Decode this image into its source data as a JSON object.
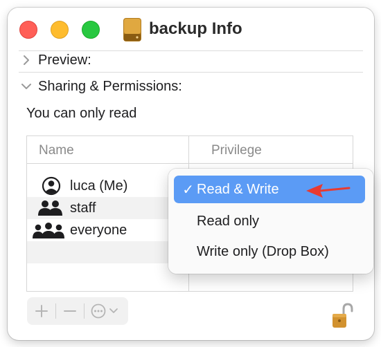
{
  "window": {
    "title": "backup Info",
    "colors": {
      "close": "#ff5f57",
      "minimize": "#febc2e",
      "maximize": "#28c840"
    }
  },
  "sections": {
    "preview_label": "Preview:",
    "sharing_label": "Sharing & Permissions:",
    "sharing_note": "You can only read"
  },
  "permissions_table": {
    "columns": [
      "Name",
      "Privilege"
    ],
    "rows": [
      {
        "name": "luca (Me)",
        "icon": "person-icon"
      },
      {
        "name": "staff",
        "icon": "group-icon"
      },
      {
        "name": "everyone",
        "icon": "everyone-icon"
      }
    ]
  },
  "toolbar": {
    "add_icon": "plus-icon",
    "remove_icon": "minus-icon",
    "action_icon": "ellipsis-circle-icon",
    "lock_icon": "unlocked-padlock-icon"
  },
  "privilege_menu": {
    "checkmark": "✓",
    "options": [
      "Read & Write",
      "Read only",
      "Write only (Drop Box)"
    ],
    "selected": "Read & Write",
    "highlight_color": "#5b9bf5",
    "annotation_color": "#e83a30"
  }
}
